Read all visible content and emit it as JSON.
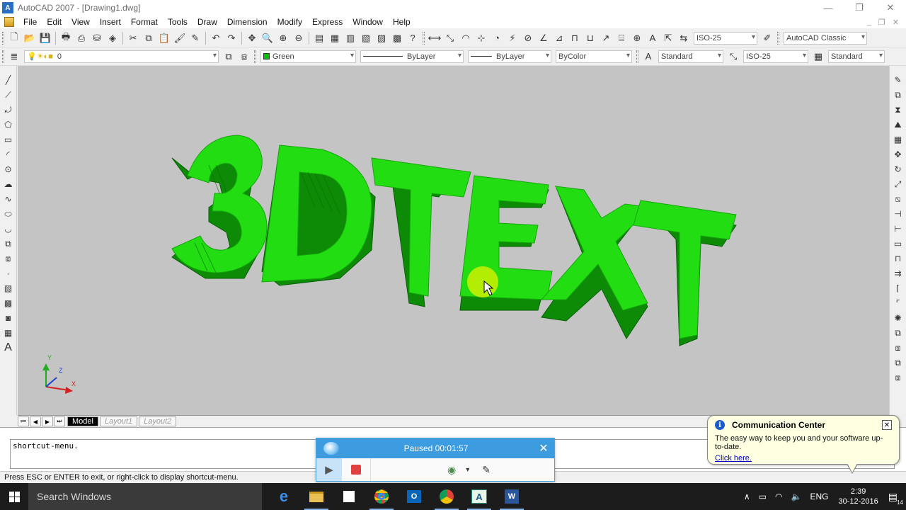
{
  "window": {
    "title": "AutoCAD 2007 - [Drawing1.dwg]",
    "minimize": "—",
    "restore": "❐",
    "close": "✕",
    "app_badge": "A"
  },
  "menu": [
    "File",
    "Edit",
    "View",
    "Insert",
    "Format",
    "Tools",
    "Draw",
    "Dimension",
    "Modify",
    "Express",
    "Window",
    "Help"
  ],
  "toolbar1": {
    "dim_style": "ISO-25",
    "workspace": "AutoCAD Classic"
  },
  "toolbar2": {
    "layer": "0",
    "color": "Green",
    "linetype": "ByLayer",
    "lineweight": "ByLayer",
    "plotstyle": "ByColor",
    "text_style": "Standard",
    "dim_style": "ISO-25",
    "table_style": "Standard"
  },
  "drawing": {
    "text": "3DTEXT",
    "face_color": "#22dd11",
    "side_color": "#0d8a06",
    "background": "#c4c4c4"
  },
  "ucs": {
    "x": "X",
    "y": "Y",
    "z": "Z"
  },
  "layout_tabs": [
    {
      "label": "Model",
      "active": true
    },
    {
      "label": "Layout1",
      "active": false
    },
    {
      "label": "Layout2",
      "active": false
    }
  ],
  "command_line": {
    "text": "shortcut-menu."
  },
  "status_bar": {
    "text": "Press ESC or ENTER to exit, or right-click to display shortcut-menu."
  },
  "recorder": {
    "status": "Paused 00:01:57"
  },
  "notification": {
    "title": "Communication Center",
    "message": "The easy way to keep you and your software up-to-date.",
    "link": "Click here."
  },
  "taskbar": {
    "search_placeholder": "Search Windows",
    "language": "ENG",
    "time": "2:39",
    "date": "30-12-2016",
    "notifications_count": "14"
  }
}
